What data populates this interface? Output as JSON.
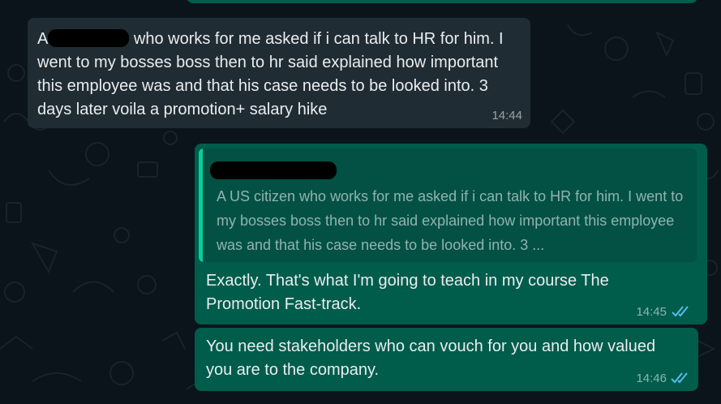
{
  "chat": {
    "messages": [
      {
        "direction": "incoming",
        "text_start": "A",
        "text_rest": " who works for me asked if i can talk to HR for him. I went to my bosses boss then to hr said explained how important this employee was and that his case needs to be looked into. 3 days later voila a promotion+ salary hike",
        "time": "14:44"
      },
      {
        "direction": "outgoing",
        "quoted_text": "A US citizen who works for me asked if i can talk to HR for him. I went to my bosses boss then to hr said explained how important this employee was and that his case needs to be looked into. 3 ...",
        "text": "Exactly. That's what I'm going to teach in my course The Promotion Fast-track.",
        "time": "14:45",
        "status_icon": "double-check-read-icon"
      },
      {
        "direction": "outgoing",
        "text": "You need stakeholders who can vouch for you and how valued you are to the company.",
        "time": "14:46",
        "status_icon": "double-check-read-icon"
      }
    ]
  },
  "colors": {
    "background": "#0b141a",
    "incoming_bubble": "#202c33",
    "outgoing_bubble": "#005c4b",
    "quote_bar": "#06cf9c",
    "read_ticks": "#53bdeb"
  }
}
